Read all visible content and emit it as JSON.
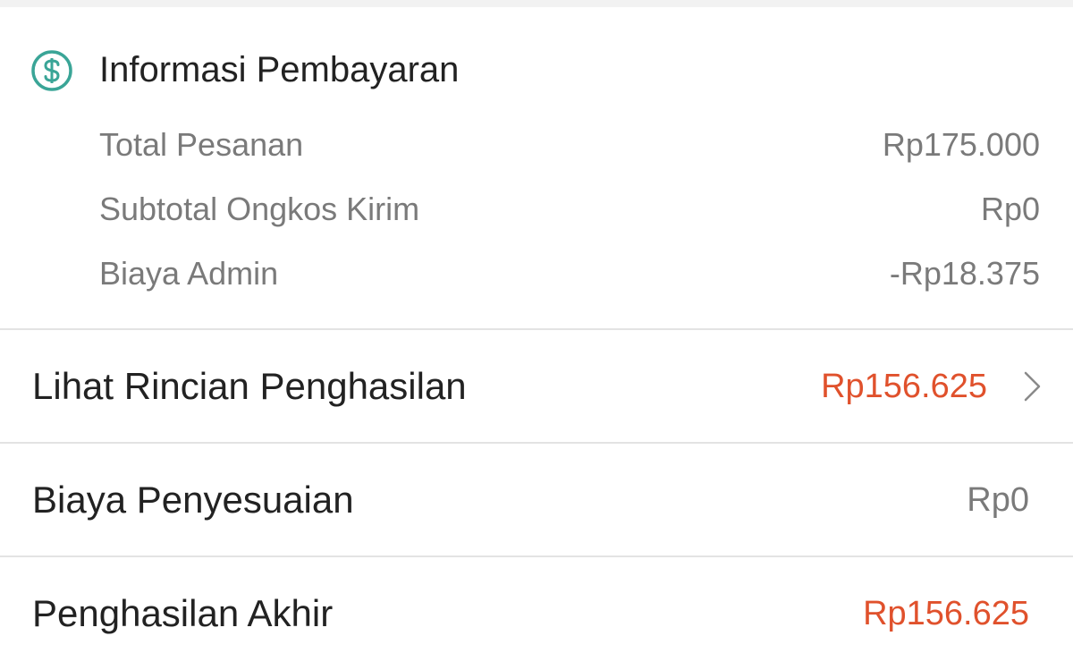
{
  "payment_info": {
    "title": "Informasi Pembayaran",
    "icon": "dollar-circle-icon",
    "icon_color": "#3aa597",
    "rows": [
      {
        "label": "Total Pesanan",
        "value": "Rp175.000"
      },
      {
        "label": "Subtotal Ongkos Kirim",
        "value": "Rp0"
      },
      {
        "label": "Biaya Admin",
        "value": "-Rp18.375"
      }
    ]
  },
  "earnings_detail": {
    "label": "Lihat Rincian Penghasilan",
    "value": "Rp156.625",
    "value_color": "#e0512c"
  },
  "adjustment": {
    "label": "Biaya Penyesuaian",
    "value": "Rp0"
  },
  "final_earnings": {
    "label": "Penghasilan Akhir",
    "value": "Rp156.625",
    "value_color": "#e0512c"
  }
}
